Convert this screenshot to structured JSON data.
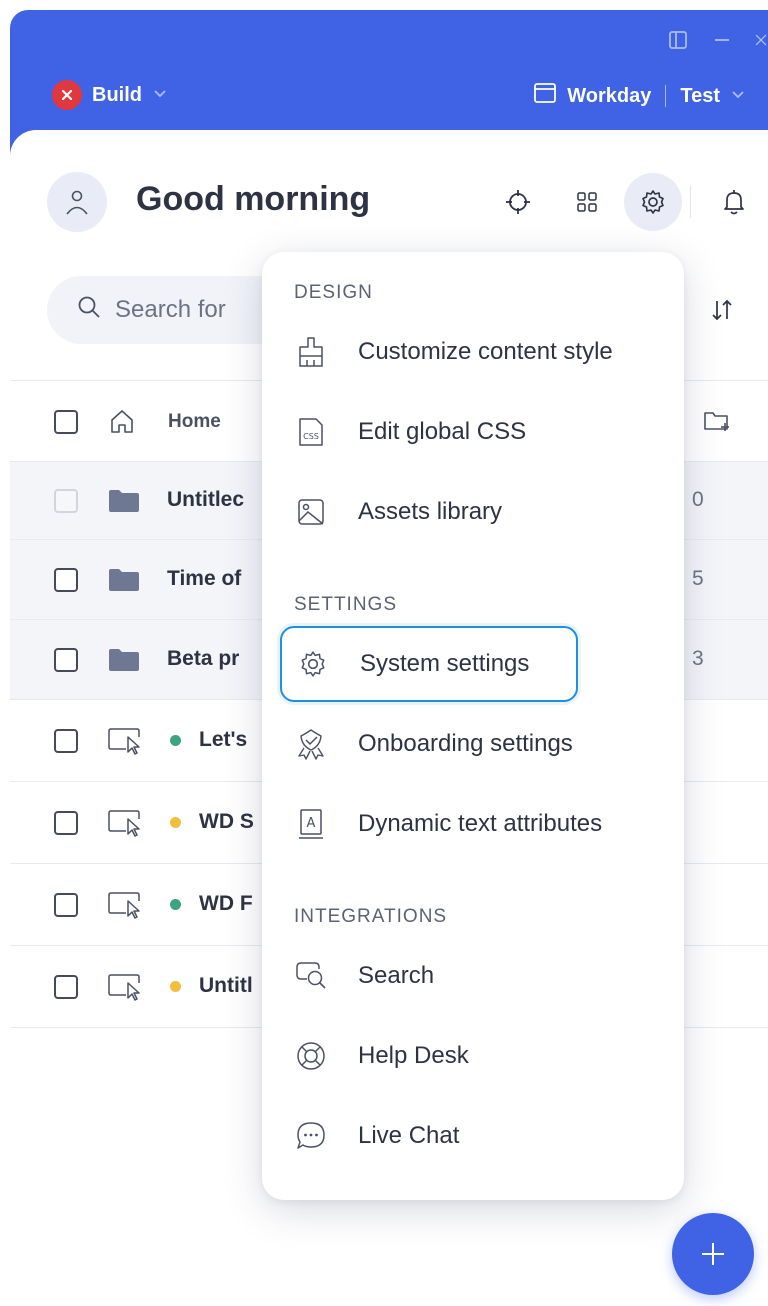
{
  "topbar": {
    "mode_label": "Build",
    "system_label": "Workday",
    "environment_label": "Test"
  },
  "header": {
    "greeting": "Good morning"
  },
  "search": {
    "placeholder": "Search for"
  },
  "list": {
    "home_label": "Home",
    "folders": [
      {
        "label": "Untitlec",
        "trail": "0"
      },
      {
        "label": "Time of",
        "trail": "5"
      },
      {
        "label": "Beta pr",
        "trail": "3"
      }
    ],
    "items": [
      {
        "label": "Let's",
        "status_color": "#3aa57e"
      },
      {
        "label": "WD S",
        "status_color": "#f0bf3c"
      },
      {
        "label": "WD F",
        "status_color": "#3aa57e"
      },
      {
        "label": "Untitl",
        "status_color": "#f0bf3c"
      }
    ]
  },
  "menu": {
    "sections": [
      {
        "title": "DESIGN",
        "items": [
          {
            "label": "Customize content style",
            "icon": "paint-brush-icon"
          },
          {
            "label": "Edit global CSS",
            "icon": "css-file-icon"
          },
          {
            "label": "Assets library",
            "icon": "image-icon"
          }
        ]
      },
      {
        "title": "SETTINGS",
        "items": [
          {
            "label": "System settings",
            "icon": "gear-icon",
            "selected": true
          },
          {
            "label": "Onboarding settings",
            "icon": "badge-check-icon"
          },
          {
            "label": "Dynamic text attributes",
            "icon": "text-attribute-icon"
          }
        ]
      },
      {
        "title": "INTEGRATIONS",
        "items": [
          {
            "label": "Search",
            "icon": "chat-search-icon"
          },
          {
            "label": "Help Desk",
            "icon": "lifebuoy-icon"
          },
          {
            "label": "Live Chat",
            "icon": "chat-bubble-icon"
          }
        ]
      }
    ]
  },
  "colors": {
    "brand": "#3f63e4",
    "danger": "#e0383e",
    "focus": "#1f8fe3"
  }
}
